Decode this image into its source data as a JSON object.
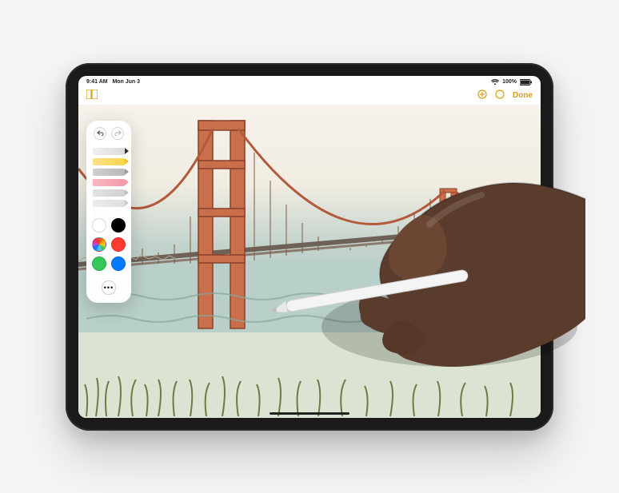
{
  "statusbar": {
    "time": "9:41 AM",
    "date": "Mon Jun 3",
    "battery_pct": "100%"
  },
  "appbar": {
    "done_label": "Done"
  },
  "palette": {
    "tools": [
      {
        "name": "pen"
      },
      {
        "name": "marker"
      },
      {
        "name": "pencil"
      },
      {
        "name": "eraser"
      },
      {
        "name": "lasso"
      },
      {
        "name": "ruler"
      }
    ],
    "swatches": [
      {
        "name": "white",
        "hex": "#ffffff"
      },
      {
        "name": "black",
        "hex": "#000000"
      },
      {
        "name": "multi",
        "hex": "multi"
      },
      {
        "name": "red",
        "hex": "#ff3b30"
      },
      {
        "name": "green",
        "hex": "#34c759"
      },
      {
        "name": "blue",
        "hex": "#007aff"
      }
    ]
  },
  "accent_color": "#d4a017"
}
